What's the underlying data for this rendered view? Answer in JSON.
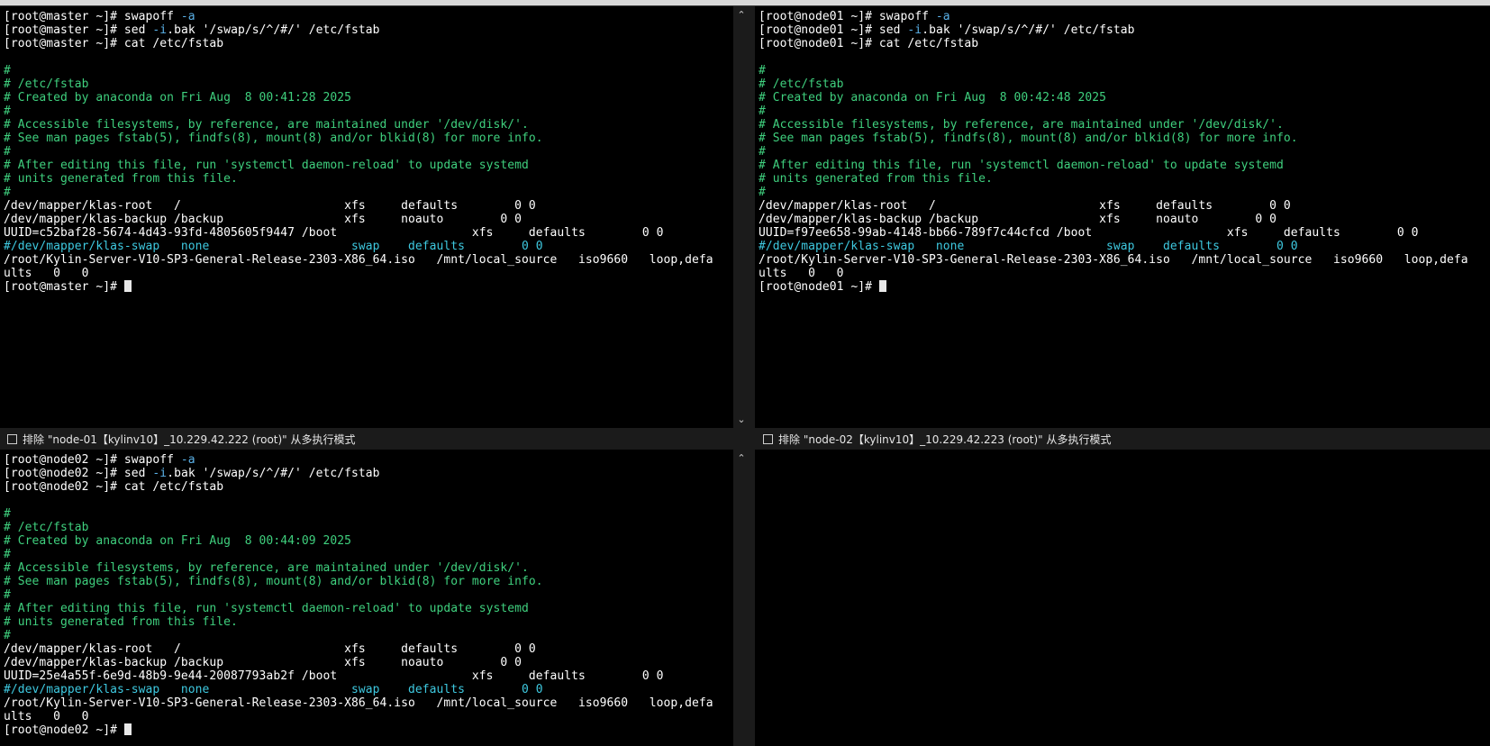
{
  "panes": {
    "master": {
      "lines": [
        {
          "segs": [
            {
              "t": "[root@master ~]# swapoff "
            },
            {
              "t": "-a",
              "c": "arg"
            }
          ]
        },
        {
          "segs": [
            {
              "t": "[root@master ~]# sed "
            },
            {
              "t": "-i",
              "c": "arg"
            },
            {
              "t": ".bak '/swap/s/^/#/' /etc/fstab"
            }
          ]
        },
        {
          "segs": [
            {
              "t": "[root@master ~]# cat /etc/fstab"
            }
          ]
        },
        {
          "segs": [
            {
              "t": ""
            }
          ]
        },
        {
          "segs": [
            {
              "t": "#",
              "c": "green"
            }
          ]
        },
        {
          "segs": [
            {
              "t": "# /etc/fstab",
              "c": "green"
            }
          ]
        },
        {
          "segs": [
            {
              "t": "# Created by anaconda on Fri Aug  8 00:41:28 2025",
              "c": "green"
            }
          ]
        },
        {
          "segs": [
            {
              "t": "#",
              "c": "green"
            }
          ]
        },
        {
          "segs": [
            {
              "t": "# Accessible filesystems, by reference, are maintained under '/dev/disk/'.",
              "c": "green"
            }
          ]
        },
        {
          "segs": [
            {
              "t": "# See man pages fstab(5), findfs(8), mount(8) and/or blkid(8) for more info.",
              "c": "green"
            }
          ]
        },
        {
          "segs": [
            {
              "t": "#",
              "c": "green"
            }
          ]
        },
        {
          "segs": [
            {
              "t": "# After editing this file, run 'systemctl daemon-reload' to update systemd",
              "c": "green"
            }
          ]
        },
        {
          "segs": [
            {
              "t": "# units generated from this file.",
              "c": "green"
            }
          ]
        },
        {
          "segs": [
            {
              "t": "#",
              "c": "green"
            }
          ]
        },
        {
          "segs": [
            {
              "t": "/dev/mapper/klas-root   /                       xfs     defaults        0 0"
            }
          ]
        },
        {
          "segs": [
            {
              "t": "/dev/mapper/klas-backup /backup                 xfs     noauto        0 0"
            }
          ]
        },
        {
          "segs": [
            {
              "t": "UUID=c52baf28-5674-4d43-93fd-4805605f9447 /boot                   xfs     defaults        0 0"
            }
          ]
        },
        {
          "segs": [
            {
              "t": "#/dev/mapper/klas-swap   none                    swap    defaults        0 0",
              "c": "cyan"
            }
          ]
        },
        {
          "segs": [
            {
              "t": "/root/Kylin-Server-V10-SP3-General-Release-2303-X86_64.iso   /mnt/local_source   iso9660   loop,defa"
            }
          ]
        },
        {
          "segs": [
            {
              "t": "ults   0   0"
            }
          ]
        },
        {
          "segs": [
            {
              "t": "[root@master ~]# "
            }
          ],
          "cursor": true
        }
      ]
    },
    "node01": {
      "lines": [
        {
          "segs": [
            {
              "t": "[root@node01 ~]# swapoff "
            },
            {
              "t": "-a",
              "c": "arg"
            }
          ]
        },
        {
          "segs": [
            {
              "t": "[root@node01 ~]# sed "
            },
            {
              "t": "-i",
              "c": "arg"
            },
            {
              "t": ".bak '/swap/s/^/#/' /etc/fstab"
            }
          ]
        },
        {
          "segs": [
            {
              "t": "[root@node01 ~]# cat /etc/fstab"
            }
          ]
        },
        {
          "segs": [
            {
              "t": ""
            }
          ]
        },
        {
          "segs": [
            {
              "t": "#",
              "c": "green"
            }
          ]
        },
        {
          "segs": [
            {
              "t": "# /etc/fstab",
              "c": "green"
            }
          ]
        },
        {
          "segs": [
            {
              "t": "# Created by anaconda on Fri Aug  8 00:42:48 2025",
              "c": "green"
            }
          ]
        },
        {
          "segs": [
            {
              "t": "#",
              "c": "green"
            }
          ]
        },
        {
          "segs": [
            {
              "t": "# Accessible filesystems, by reference, are maintained under '/dev/disk/'.",
              "c": "green"
            }
          ]
        },
        {
          "segs": [
            {
              "t": "# See man pages fstab(5), findfs(8), mount(8) and/or blkid(8) for more info.",
              "c": "green"
            }
          ]
        },
        {
          "segs": [
            {
              "t": "#",
              "c": "green"
            }
          ]
        },
        {
          "segs": [
            {
              "t": "# After editing this file, run 'systemctl daemon-reload' to update systemd",
              "c": "green"
            }
          ]
        },
        {
          "segs": [
            {
              "t": "# units generated from this file.",
              "c": "green"
            }
          ]
        },
        {
          "segs": [
            {
              "t": "#",
              "c": "green"
            }
          ]
        },
        {
          "segs": [
            {
              "t": "/dev/mapper/klas-root   /                       xfs     defaults        0 0"
            }
          ]
        },
        {
          "segs": [
            {
              "t": "/dev/mapper/klas-backup /backup                 xfs     noauto        0 0"
            }
          ]
        },
        {
          "segs": [
            {
              "t": "UUID=f97ee658-99ab-4148-bb66-789f7c44cfcd /boot                   xfs     defaults        0 0"
            }
          ]
        },
        {
          "segs": [
            {
              "t": "#/dev/mapper/klas-swap   none                    swap    defaults        0 0",
              "c": "cyan"
            }
          ]
        },
        {
          "segs": [
            {
              "t": "/root/Kylin-Server-V10-SP3-General-Release-2303-X86_64.iso   /mnt/local_source   iso9660   loop,defa"
            }
          ]
        },
        {
          "segs": [
            {
              "t": "ults   0   0"
            }
          ]
        },
        {
          "segs": [
            {
              "t": "[root@node01 ~]# "
            }
          ],
          "cursor": true
        }
      ]
    },
    "node02": {
      "lines": [
        {
          "segs": [
            {
              "t": "[root@node02 ~]# swapoff "
            },
            {
              "t": "-a",
              "c": "arg"
            }
          ]
        },
        {
          "segs": [
            {
              "t": "[root@node02 ~]# sed "
            },
            {
              "t": "-i",
              "c": "arg"
            },
            {
              "t": ".bak '/swap/s/^/#/' /etc/fstab"
            }
          ]
        },
        {
          "segs": [
            {
              "t": "[root@node02 ~]# cat /etc/fstab"
            }
          ]
        },
        {
          "segs": [
            {
              "t": ""
            }
          ]
        },
        {
          "segs": [
            {
              "t": "#",
              "c": "green"
            }
          ]
        },
        {
          "segs": [
            {
              "t": "# /etc/fstab",
              "c": "green"
            }
          ]
        },
        {
          "segs": [
            {
              "t": "# Created by anaconda on Fri Aug  8 00:44:09 2025",
              "c": "green"
            }
          ]
        },
        {
          "segs": [
            {
              "t": "#",
              "c": "green"
            }
          ]
        },
        {
          "segs": [
            {
              "t": "# Accessible filesystems, by reference, are maintained under '/dev/disk/'.",
              "c": "green"
            }
          ]
        },
        {
          "segs": [
            {
              "t": "# See man pages fstab(5), findfs(8), mount(8) and/or blkid(8) for more info.",
              "c": "green"
            }
          ]
        },
        {
          "segs": [
            {
              "t": "#",
              "c": "green"
            }
          ]
        },
        {
          "segs": [
            {
              "t": "# After editing this file, run 'systemctl daemon-reload' to update systemd",
              "c": "green"
            }
          ]
        },
        {
          "segs": [
            {
              "t": "# units generated from this file.",
              "c": "green"
            }
          ]
        },
        {
          "segs": [
            {
              "t": "#",
              "c": "green"
            }
          ]
        },
        {
          "segs": [
            {
              "t": "/dev/mapper/klas-root   /                       xfs     defaults        0 0"
            }
          ]
        },
        {
          "segs": [
            {
              "t": "/dev/mapper/klas-backup /backup                 xfs     noauto        0 0"
            }
          ]
        },
        {
          "segs": [
            {
              "t": "UUID=25e4a55f-6e9d-48b9-9e44-20087793ab2f /boot                   xfs     defaults        0 0"
            }
          ]
        },
        {
          "segs": [
            {
              "t": "#/dev/mapper/klas-swap   none                    swap    defaults        0 0",
              "c": "cyan"
            }
          ]
        },
        {
          "segs": [
            {
              "t": "/root/Kylin-Server-V10-SP3-General-Release-2303-X86_64.iso   /mnt/local_source   iso9660   loop,defa"
            }
          ]
        },
        {
          "segs": [
            {
              "t": "ults   0   0"
            }
          ]
        },
        {
          "segs": [
            {
              "t": "[root@node02 ~]# "
            }
          ],
          "cursor": true
        }
      ]
    }
  },
  "exclude_bars": {
    "left": "排除 \"node-01【kylinv10】_10.229.42.222 (root)\" 从多执行模式",
    "right": "排除 \"node-02【kylinv10】_10.229.42.223 (root)\" 从多执行模式"
  },
  "icons": {
    "scroll_up": "chevron-up-icon",
    "scroll_down": "chevron-down-icon",
    "checkbox": "checkbox-icon"
  },
  "colors": {
    "terminal_bg": "#000000",
    "comment_green": "#3fd07e",
    "commented_swap_cyan": "#3ec9e0",
    "argument_blue": "#5ab1e8"
  }
}
